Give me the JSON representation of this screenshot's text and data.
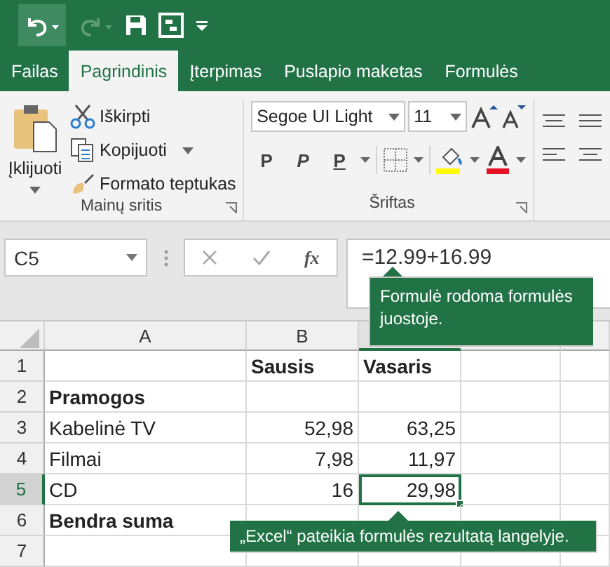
{
  "tabs": [
    {
      "label": "Failas",
      "selected": false
    },
    {
      "label": "Pagrindinis",
      "selected": true
    },
    {
      "label": "Įterpimas",
      "selected": false
    },
    {
      "label": "Puslapio maketas",
      "selected": false
    },
    {
      "label": "Formulės",
      "selected": false
    }
  ],
  "clipboard": {
    "paste": "Įklijuoti",
    "items": [
      {
        "kind": "cut",
        "label": "Iškirpti"
      },
      {
        "kind": "copy",
        "label": "Kopijuoti"
      },
      {
        "kind": "brush",
        "label": "Formato teptukas"
      }
    ],
    "group_label": "Mainų sritis"
  },
  "font": {
    "font_name": "Segoe UI Light",
    "font_size": "11",
    "styles": [
      {
        "kind": "bold",
        "label": "P"
      },
      {
        "kind": "italic",
        "label": "P"
      },
      {
        "kind": "underline",
        "label": "P"
      }
    ],
    "group_label": "Šriftas"
  },
  "formula_bar": {
    "name_box": "C5",
    "function_label": "fx",
    "formula": "=12.99+16.99"
  },
  "callouts": [
    {
      "kind": "formula",
      "text": "Formulė rodoma formulės juostoje."
    },
    {
      "kind": "cell",
      "text": "„Excel“ pateikia formulės rezultatą langelyje."
    }
  ],
  "sheet": {
    "columns": [
      {
        "label": "A",
        "selected": false
      },
      {
        "label": "B",
        "selected": false
      },
      {
        "selected": true
      },
      {
        "selected": false
      },
      {
        "selected": false
      }
    ],
    "rows": [
      {
        "number": "1",
        "kind": "header",
        "selected": false,
        "b": "Sausis",
        "c": "Vasaris"
      },
      {
        "number": "2",
        "kind": "section",
        "selected": false,
        "a": "Pramogos"
      },
      {
        "number": "3",
        "kind": "item",
        "selected": false,
        "a": "Kabelinė TV",
        "b": "52,98",
        "c": "63,25"
      },
      {
        "number": "4",
        "kind": "item",
        "selected": false,
        "a": "Filmai",
        "b": "7,98",
        "c": "11,97"
      },
      {
        "number": "5",
        "kind": "item",
        "selected": true,
        "a": "CD",
        "b": "16",
        "c": "29,98"
      },
      {
        "number": "6",
        "kind": "total",
        "selected": false,
        "a": "Bendra suma"
      },
      {
        "number": "7",
        "kind": "item",
        "selected": false
      }
    ]
  }
}
